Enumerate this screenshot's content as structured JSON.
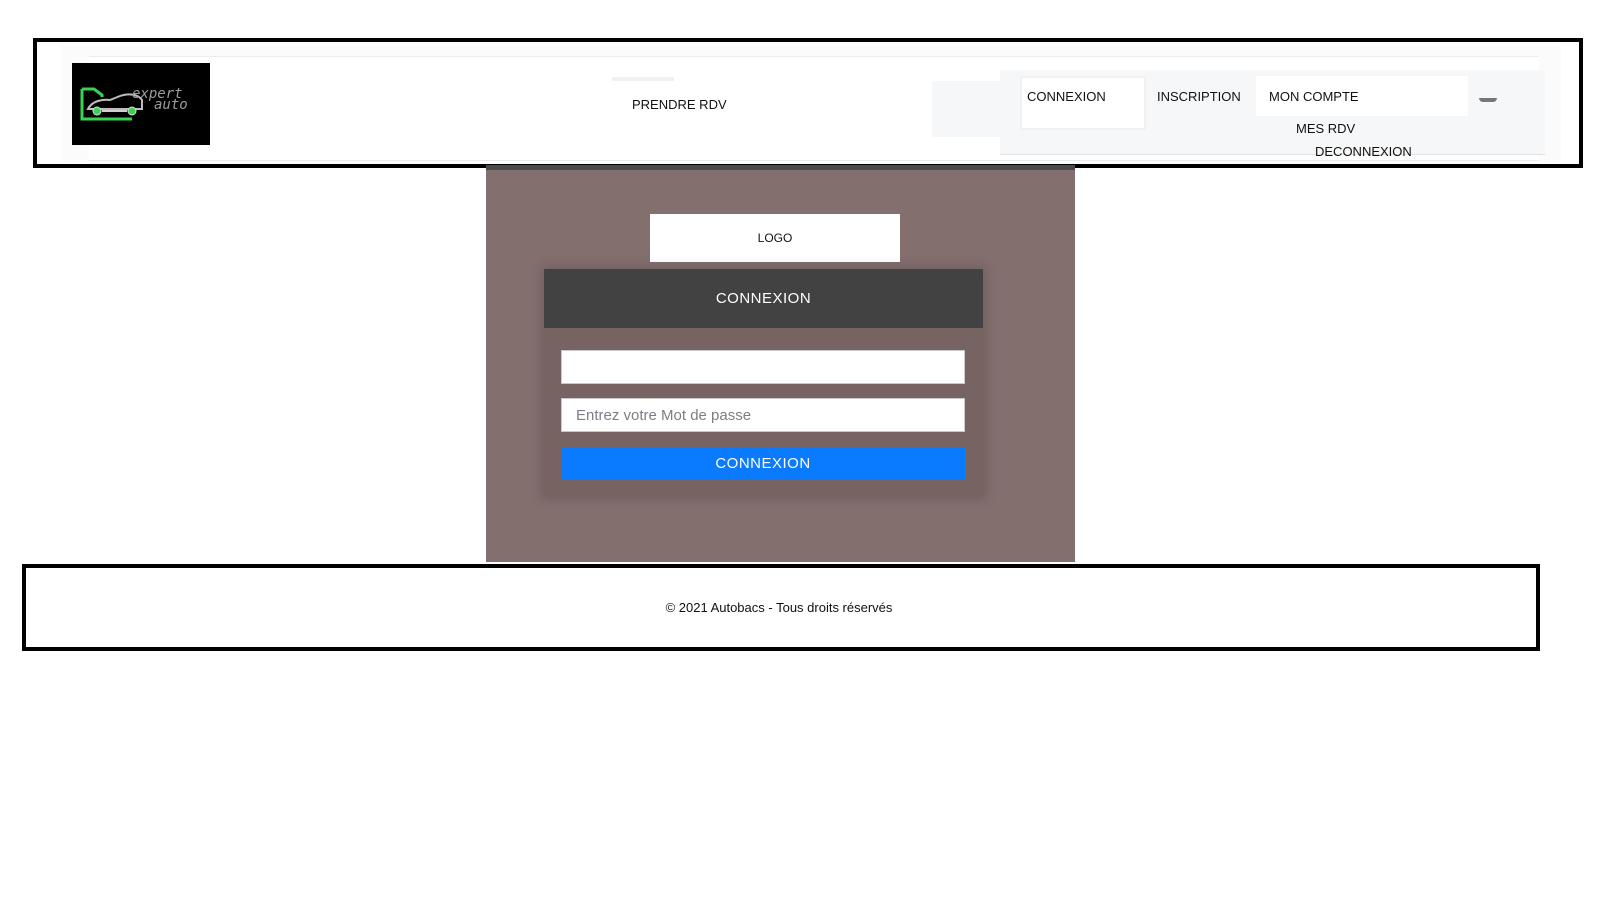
{
  "header": {
    "brand": {
      "line1": "expert",
      "line2": "auto",
      "accent": "#39d353"
    },
    "nav": {
      "prendre_rdv": "PRENDRE RDV",
      "connexion": "CONNEXION",
      "inscription": "INSCRIPTION",
      "mon_compte": "MON COMPTE",
      "dropdown": {
        "mes_rdv": "MES RDV",
        "deconnexion": "DECONNEXION"
      }
    }
  },
  "main": {
    "logo_placeholder": "LOGO",
    "card": {
      "title": "CONNEXION",
      "username": {
        "value": "",
        "placeholder": ""
      },
      "password": {
        "value": "",
        "placeholder": "Entrez votre Mot de passe"
      },
      "submit_label": "CONNEXION",
      "submit_color": "#0a7bff"
    }
  },
  "footer": {
    "text": "© 2021 Autobacs - Tous droits réservés"
  }
}
